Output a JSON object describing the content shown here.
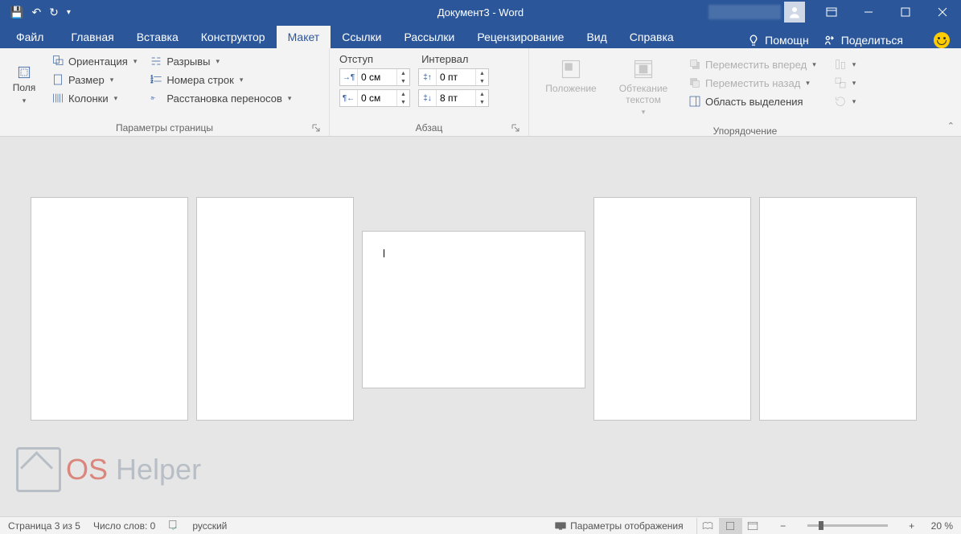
{
  "title": "Документ3 - Word",
  "qat": {
    "save": "💾",
    "undo": "↶",
    "redo": "↻",
    "more": "▾"
  },
  "win": {},
  "tabs": {
    "file": "Файл",
    "items": [
      "Главная",
      "Вставка",
      "Конструктор",
      "Макет",
      "Ссылки",
      "Рассылки",
      "Рецензирование",
      "Вид",
      "Справка"
    ],
    "active_index": 3,
    "tell_me": "Помощн",
    "share": "Поделиться"
  },
  "ribbon": {
    "page_setup": {
      "margins": "Поля",
      "orientation": "Ориентация",
      "size": "Размер",
      "columns": "Колонки",
      "breaks": "Разрывы",
      "line_numbers": "Номера строк",
      "hyphenation": "Расстановка переносов",
      "label": "Параметры страницы"
    },
    "paragraph": {
      "indent_head": "Отступ",
      "spacing_head": "Интервал",
      "left_val": "0 см",
      "right_val": "0 см",
      "before_val": "0 пт",
      "after_val": "8 пт",
      "label": "Абзац"
    },
    "arrange": {
      "position": "Положение",
      "wrap": "Обтекание текстом",
      "bring_forward": "Переместить вперед",
      "send_backward": "Переместить назад",
      "selection_pane": "Область выделения",
      "label": "Упорядочение"
    }
  },
  "status": {
    "page": "Страница 3 из 5",
    "words": "Число слов: 0",
    "lang": "русский",
    "display_settings": "Параметры отображения",
    "zoom": "20 %"
  },
  "watermark": {
    "os": "OS",
    "helper": " Helper"
  }
}
